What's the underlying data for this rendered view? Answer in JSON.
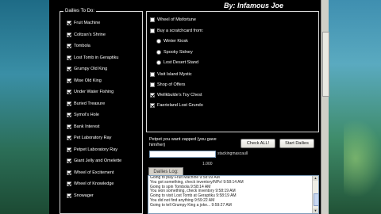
{
  "title": "By: Infamous Joe",
  "dailies": {
    "label": "Dailies To Do:",
    "items": [
      {
        "label": "Fruit Machine",
        "checked": true
      },
      {
        "label": "Coltzan's Shrine",
        "checked": true
      },
      {
        "label": "Tombola",
        "checked": true
      },
      {
        "label": "Lost Tomb in Geraptiku",
        "checked": true
      },
      {
        "label": "Grumpy Old King",
        "checked": true
      },
      {
        "label": "Wise Old King",
        "checked": true
      },
      {
        "label": "Under Water Fishing",
        "checked": true
      },
      {
        "label": "Buried Treasure",
        "checked": true
      },
      {
        "label": "Symol's Hole",
        "checked": true
      },
      {
        "label": "Bank Interest",
        "checked": true
      },
      {
        "label": "Pet Laboratory Ray",
        "checked": true
      },
      {
        "label": "Petpet Laboratory Ray",
        "checked": true
      },
      {
        "label": "Giant Jelly and Omelette",
        "checked": true
      },
      {
        "label": "Wheel of Excitement",
        "checked": true
      },
      {
        "label": "Wheel of Knowledge",
        "checked": true
      },
      {
        "label": "Snowager",
        "checked": true
      }
    ]
  },
  "right": {
    "items_top": [
      {
        "label": "Wheel of Misfortune",
        "checked": false
      },
      {
        "label": "Buy a scratchcard from:",
        "checked": false
      }
    ],
    "radios": [
      "Winter Kiosk",
      "Spooky Sidney",
      "Lost Desert Stand"
    ],
    "items_bottom": [
      {
        "label": "Visit Island Mystic",
        "checked": false
      },
      {
        "label": "Shop of Offers",
        "checked": false
      },
      {
        "label": "Wellkbulde's Toy Chest",
        "checked": true
      },
      {
        "label": "Faerieland Lost Grundo",
        "checked": true
      }
    ]
  },
  "petpet": {
    "prompt": "Petpet you want zapped (you gave him/her)",
    "input_value": "",
    "side_value": "stackingmascaull",
    "count": "1.000"
  },
  "buttons": {
    "check_all": "Check ALL!",
    "start": "Start Dailies"
  },
  "log": {
    "tab": "Dailies Log:",
    "lines": [
      "Going to play Fruit Machine 9:58:09 AM",
      "You got something, check inventory/NPs! 9:58:14 AM",
      "Going to spin Tombola 9:58:14 AM",
      "You won something, check inventory 9:58:19 AM",
      "Going to visit Lost Tomb at Geraptiku 9:58:19 AM",
      "You did not find anything 9:59:22 AM",
      "Going to tell Grumpy King a joke... 9:59:27 AM"
    ]
  }
}
